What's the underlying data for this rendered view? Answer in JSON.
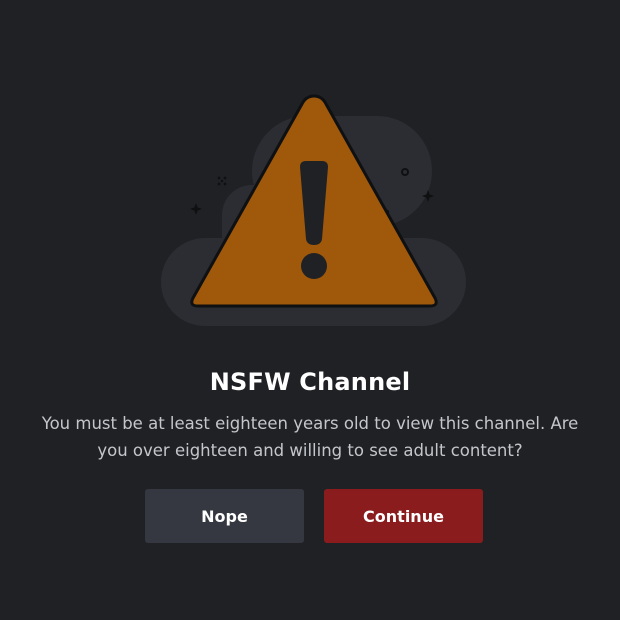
{
  "dialog": {
    "title": "NSFW Channel",
    "description": "You must be at least eighteen years old to view this channel. Are you over eighteen and willing to see adult content?",
    "nope_label": "Nope",
    "continue_label": "Continue"
  },
  "icons": {
    "warning": "warning-triangle-icon"
  },
  "colors": {
    "background": "#1f2125",
    "warning_fill": "#a0580b",
    "cancel_button": "#353841",
    "confirm_button": "#8b1c1e",
    "title_text": "#ffffff",
    "body_text": "#c4c6cb"
  }
}
